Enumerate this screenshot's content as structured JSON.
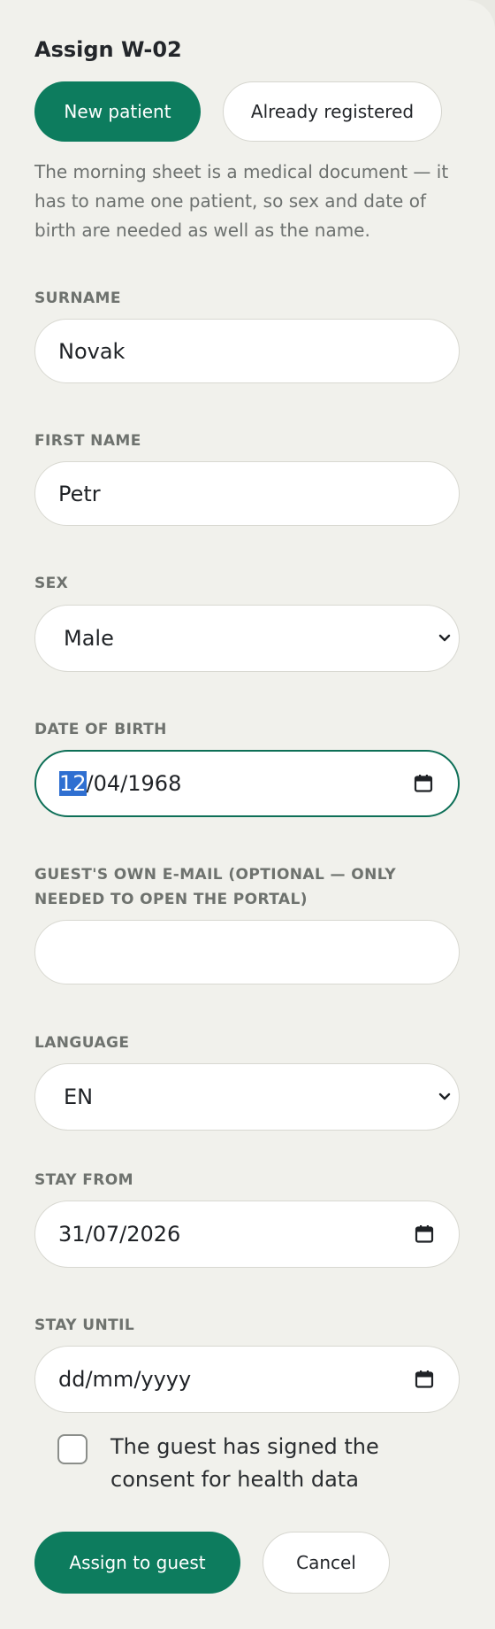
{
  "form": {
    "title": "Assign W-02",
    "mode_tabs": {
      "new_patient": "New patient",
      "already_registered": "Already registered",
      "selected": "New patient"
    },
    "intro_text": "The morning sheet is a medical document — it has to name one patient, so sex and date of birth are needed as well as the name.",
    "surname": {
      "label": "SURNAME",
      "value": "Novak"
    },
    "first_name": {
      "label": "FIRST NAME",
      "value": "Petr"
    },
    "sex": {
      "label": "SEX",
      "value": "Male"
    },
    "date_of_birth": {
      "label": "DATE OF BIRTH",
      "day": "12",
      "rest": "/04/1968"
    },
    "email": {
      "label": "GUEST'S OWN E-MAIL (OPTIONAL — ONLY NEEDED TO OPEN THE PORTAL)",
      "value": ""
    },
    "language": {
      "label": "LANGUAGE",
      "value": "EN"
    },
    "stay_from": {
      "label": "STAY FROM",
      "value": "31/07/2026"
    },
    "stay_until": {
      "label": "STAY UNTIL",
      "placeholder": "dd/mm/yyyy"
    },
    "consent": {
      "text": "The guest has signed the consent for health data",
      "checked": false
    },
    "actions": {
      "assign": "Assign to guest",
      "cancel": "Cancel"
    }
  },
  "colors": {
    "accent": "#0d7c5e",
    "panel_background": "#f1f1ec",
    "selection_highlight": "#2f6fd1"
  },
  "icons": {
    "calendar": "calendar-icon",
    "dropdown": "chevron-down-icon"
  }
}
